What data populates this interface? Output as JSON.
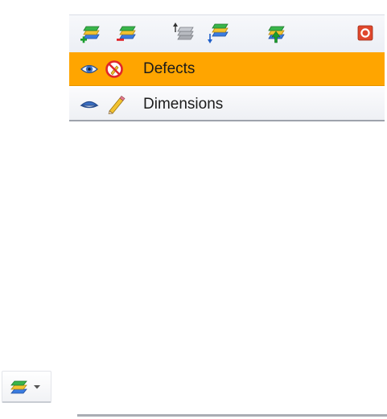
{
  "toolbar": {
    "buttons": [
      {
        "icon": "add-layer-icon"
      },
      {
        "icon": "remove-layer-icon"
      },
      {
        "icon": "move-layer-up-icon"
      },
      {
        "icon": "move-layer-down-icon"
      },
      {
        "icon": "import-layer-icon"
      },
      {
        "icon": "close-panel-icon"
      }
    ]
  },
  "layers": [
    {
      "label": "Defects",
      "selected": true,
      "visibility_icon": "eye-icon",
      "edit_icon": "editing-disabled-icon"
    },
    {
      "label": "Dimensions",
      "selected": false,
      "visibility_icon": "eye-closed-icon",
      "edit_icon": "pencil-icon"
    }
  ],
  "layers_dropdown": {
    "icon": "layers-icon",
    "arrow_icon": "dropdown-arrow-icon"
  },
  "colors": {
    "selected_row": "#ffa500",
    "toolbar_bg": "#eceff5",
    "layer_green": "#39b54a",
    "layer_blue": "#3a7be0",
    "layer_yellow": "#f2c230",
    "remove_red": "#e0262b",
    "close_red": "#e0472c"
  }
}
